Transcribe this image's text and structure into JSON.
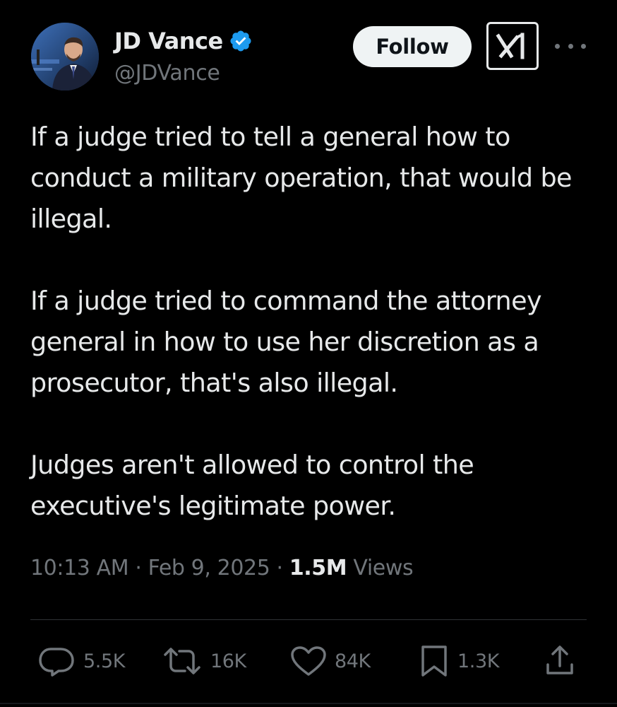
{
  "header": {
    "display_name": "JD Vance",
    "handle": "@JDVance",
    "follow_label": "Follow",
    "verified_icon": "verified-badge-icon",
    "grok_icon": "grok-icon",
    "more_icon": "more-dots-icon"
  },
  "tweet": {
    "paragraphs": [
      "If a judge tried to tell a general how to conduct a military operation, that would be illegal.",
      "If a judge tried to command the attorney general in how to use her discretion as a prosecutor, that's also illegal.",
      "Judges aren't allowed to control the executive's legitimate power."
    ]
  },
  "meta": {
    "time": "10:13 AM",
    "separator": "·",
    "date": "Feb 9, 2025",
    "views_count": "1.5M",
    "views_label": "Views"
  },
  "actions": {
    "replies": "5.5K",
    "reposts": "16K",
    "likes": "84K",
    "bookmarks": "1.3K"
  },
  "colors": {
    "background": "#000000",
    "primary_text": "#e7e9ea",
    "secondary_text": "#71767b",
    "verified_blue": "#1d9bf0",
    "follow_bg": "#eff3f4"
  }
}
